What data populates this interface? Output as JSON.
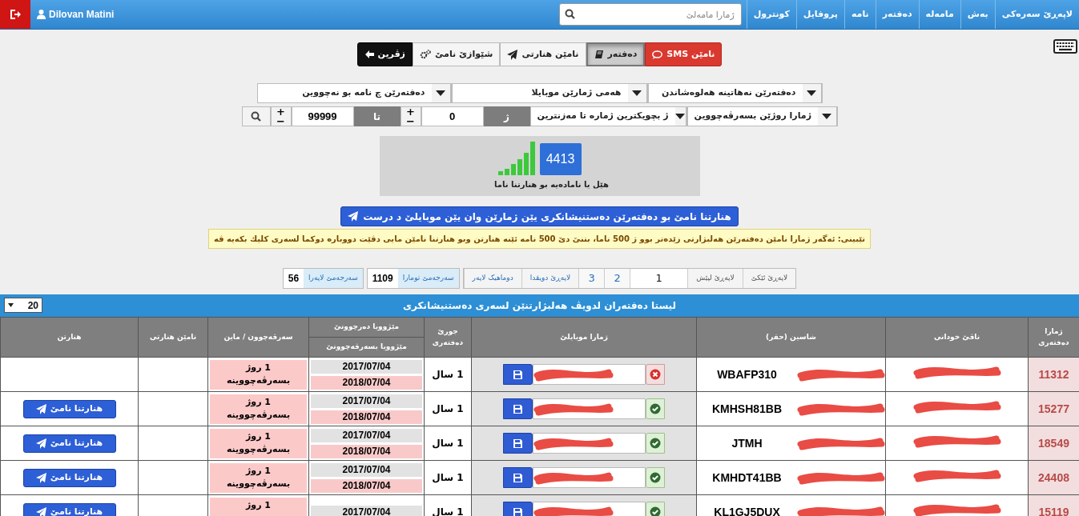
{
  "navbar": {
    "user": "Dilovan Matini",
    "search": {
      "placeholder": "ژمارا مامەلێ"
    },
    "items": [
      {
        "label": "لاپەڕێ سەرەکی"
      },
      {
        "label": "بەش"
      },
      {
        "label": "مامەلە"
      },
      {
        "label": "دەفتەر"
      },
      {
        "label": "نامە"
      },
      {
        "label": "پروفایل"
      },
      {
        "label": "کونترول"
      }
    ]
  },
  "tabs": [
    {
      "kind": "sms",
      "label": "نامێن SMS",
      "selected": false
    },
    {
      "kind": "book",
      "label": "دەفتەر",
      "selected": true
    },
    {
      "kind": "send",
      "label": "نامێن هنارتی",
      "selected": false
    },
    {
      "kind": "gears",
      "label": "شێوازێ نامێ",
      "selected": false
    },
    {
      "kind": "back",
      "label": "زڤرین",
      "selected": false
    }
  ],
  "filters": {
    "row_1": [
      "دەفتەرێن نەهاتینە هەلوەشاندن",
      "هەمی ژمارێن موبایلا",
      "دەفتەرێن چ نامە بو نەچووین"
    ],
    "row_2": {
      "field_select": "ژمارا روژێن بسەرڤەچووین",
      "order_select": "ژ بچویکترین ژمارە تا مەزنترین",
      "from_label": "ژ",
      "from_value": "0",
      "to_label": "تا",
      "to_value": "99999",
      "plus": "+",
      "minus": "−"
    }
  },
  "status_panel": {
    "count": "4413",
    "caption": "هێل یا نامادەیە بو هنارتنا ناما"
  },
  "send_all_button": "هنارتنا نامێ بو دەفتەرێن دەستنیشانکری یێن ژمارێن وان یێن موبایلێ د درست",
  "note": "تێبینی: ئەگەر ژمارا نامێن دەفتەرێن هەلبژارتی زێدەتر بوو ژ **500** ناما، بتنێ دێ **500** نامە ئێنە هنارتن وبو هنارتنا نامێن مایی دڤێت دووبارە دوکما لسەری کلیك بکەیە ڤە",
  "pagination": {
    "pages": [
      {
        "kind": "nav",
        "label": "لاپەڕێ ئێکێ",
        "selected": false
      },
      {
        "kind": "nav",
        "label": "لاپەڕێ لپێش",
        "selected": false
      },
      {
        "kind": "page",
        "label": "1",
        "selected": true
      },
      {
        "kind": "page",
        "label": "2",
        "selected": false
      },
      {
        "kind": "page",
        "label": "3",
        "selected": false
      },
      {
        "kind": "nav",
        "label": "لاپەڕێ دویڤدا",
        "selected": false
      },
      {
        "kind": "nav",
        "label": "دوماهیک لاپەر",
        "selected": false
      }
    ],
    "totals": [
      {
        "label": "سەرجەمێ تومارا",
        "value": "1109"
      },
      {
        "label": "سەرجەمێ لاپەرا",
        "value": "56"
      }
    ]
  },
  "table": {
    "title": "لیستا دەفتەران لدویڤ هەلبژارتنێن لسەری دەستنیشانکری",
    "page_size": "20",
    "columns": [
      "ژمارا دەفتەری",
      "ناڤێ خودانی",
      "شاسین (حقر)",
      "ژمارا موبایلێ",
      "جورێ دەفتەری",
      [
        "مێژوویا دەرچوونێ",
        "مێژوویا بسەرڤەچوونێ"
      ],
      "سەرڤەچوون / ماین",
      "نامێن هنارتی",
      "هنارتن"
    ],
    "rows": [
      {
        "number": "11312",
        "chassis": "WBAFP310",
        "phone_valid": false,
        "type": "1 سال",
        "issued": "2017/07/04",
        "expiry": "2018/07/04",
        "remaining": [
          "1 روژ",
          "بسەرڤەچووینە"
        ],
        "send_button": null
      },
      {
        "number": "15277",
        "chassis": "KMHSH81BB",
        "phone_valid": true,
        "type": "1 سال",
        "issued": "2017/07/04",
        "expiry": "2018/07/04",
        "remaining": [
          "1 روژ",
          "بسەرڤەچووینە"
        ],
        "send_button": "هنارتنا نامێ"
      },
      {
        "number": "18549",
        "chassis": "JTMH",
        "phone_valid": true,
        "type": "1 سال",
        "issued": "2017/07/04",
        "expiry": "2018/07/04",
        "remaining": [
          "1 روژ",
          "بسەرڤەچووینە"
        ],
        "send_button": "هنارتنا نامێ"
      },
      {
        "number": "24408",
        "chassis": "KMHDT41BB",
        "phone_valid": true,
        "type": "1 سال",
        "issued": "2017/07/04",
        "expiry": "2018/07/04",
        "remaining": [
          "1 روژ",
          "بسەرڤەچووینە"
        ],
        "send_button": "هنارتنا نامێ"
      },
      {
        "number": "15119",
        "chassis": "KL1GJ5DUX",
        "phone_valid": true,
        "type": "1 سال",
        "issued": "2017/07/04",
        "remaining": [
          "1 روژ"
        ],
        "send_button": "هنارتنا نامێ"
      }
    ]
  }
}
